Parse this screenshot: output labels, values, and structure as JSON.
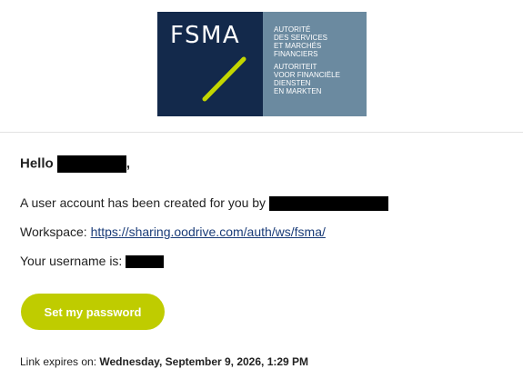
{
  "logo": {
    "wordmark": "FSMA",
    "fr_lines": [
      "AUTORITÉ",
      "DES SERVICES",
      "ET MARCHÉS",
      "FINANCIERS"
    ],
    "nl_lines": [
      "AUTORITEIT",
      "VOOR FINANCIËLE",
      "DIENSTEN",
      "EN MARKTEN"
    ],
    "colors": {
      "dark": "#13294b",
      "panel": "#6b8aa0",
      "slash": "#c3d600"
    }
  },
  "greeting": {
    "prefix": "Hello",
    "suffix": ","
  },
  "account_line": "A user account has been created for you by",
  "workspace": {
    "label": "Workspace:",
    "url": "https://sharing.oodrive.com/auth/ws/fsma/"
  },
  "username_label": "Your username is:",
  "set_password_button": "Set my password",
  "expiry": {
    "label": "Link expires on:",
    "date": "Wednesday, September 9, 2026, 1:29 PM"
  },
  "button_color": "#bfcc00"
}
